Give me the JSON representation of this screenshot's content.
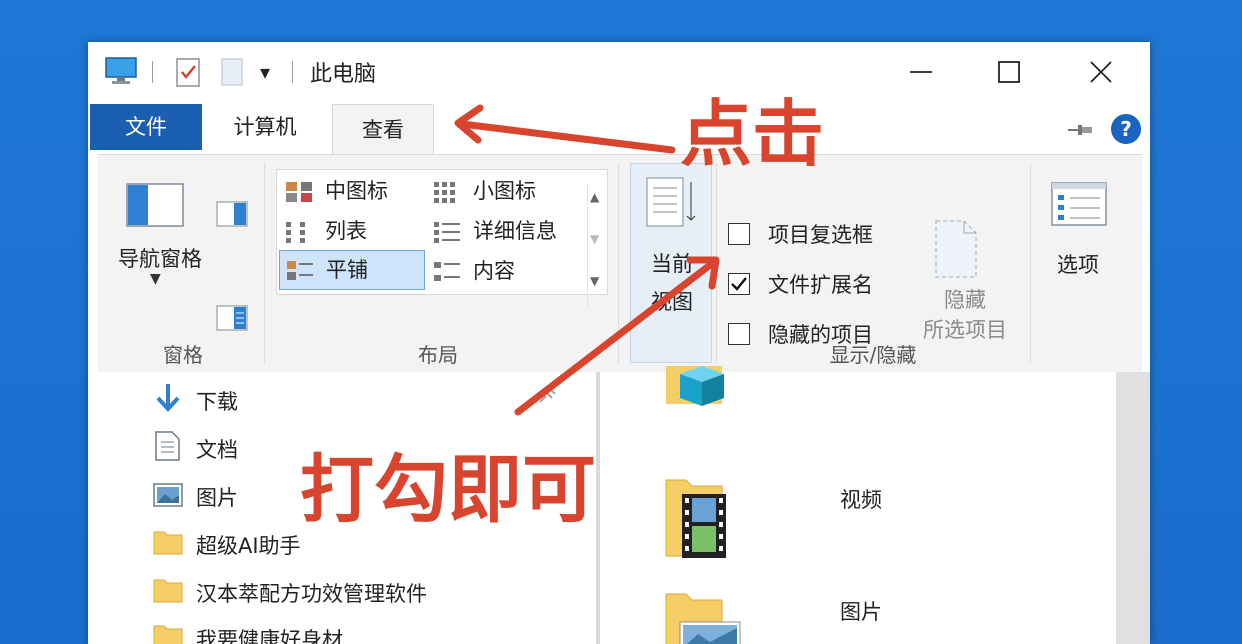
{
  "window": {
    "title": "此电脑",
    "quick_access_dropdown": "▾",
    "buttons": {
      "minimize": "minimize",
      "maximize": "maximize",
      "close": "close"
    }
  },
  "tabs": {
    "file": "文件",
    "computer": "计算机",
    "view": "查看",
    "help": "?"
  },
  "ribbon": {
    "panes": {
      "nav_pane_label": "导航窗格",
      "group_label": "窗格"
    },
    "layout": {
      "group_label": "布局",
      "items": [
        {
          "label": "中图标"
        },
        {
          "label": "小图标"
        },
        {
          "label": "列表"
        },
        {
          "label": "详细信息"
        },
        {
          "label": "平铺",
          "selected": true
        },
        {
          "label": "内容"
        }
      ]
    },
    "current_view": {
      "label_line1": "当前",
      "label_line2": "视图"
    },
    "show_hide": {
      "group_label": "显示/隐藏",
      "checkboxes": [
        {
          "label": "项目复选框",
          "checked": false
        },
        {
          "label": "文件扩展名",
          "checked": true
        },
        {
          "label": "隐藏的项目",
          "checked": false
        }
      ],
      "hide_selected_line1": "隐藏",
      "hide_selected_line2": "所选项目"
    },
    "options": {
      "label": "选项"
    }
  },
  "nav_pane": {
    "items": [
      {
        "label": "下载",
        "icon": "download-icon"
      },
      {
        "label": "文档",
        "icon": "document-icon"
      },
      {
        "label": "图片",
        "icon": "picture-icon"
      },
      {
        "label": "超级AI助手",
        "icon": "folder-icon"
      },
      {
        "label": "汉本萃配方功效管理软件",
        "icon": "folder-icon"
      },
      {
        "label": "我要健康好身材",
        "icon": "folder-icon"
      }
    ]
  },
  "main_pane": {
    "tiles": [
      {
        "label": "",
        "icon": "3d-objects-folder-icon"
      },
      {
        "label": "视频",
        "icon": "videos-folder-icon"
      },
      {
        "label": "图片",
        "icon": "pictures-folder-icon"
      }
    ]
  },
  "annotations": {
    "click": "点击",
    "check": "打勾即可",
    "color": "#d9442f"
  },
  "colors": {
    "file_tab": "#1b5fb3",
    "desktop": "#1f78d6",
    "ribbon": "#f3f3f3",
    "selection": "#cde4fa"
  }
}
